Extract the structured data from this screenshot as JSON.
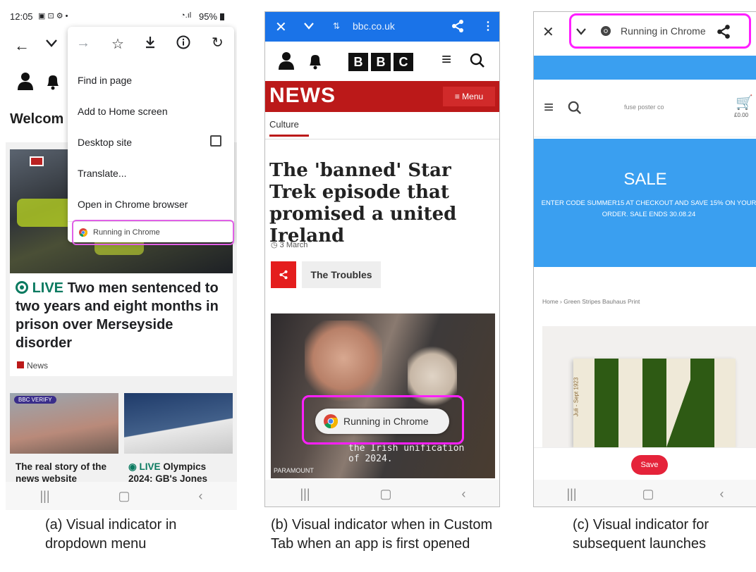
{
  "panel_a": {
    "status": {
      "time": "12:05",
      "battery": "95%"
    },
    "page_heading": "Welcom",
    "menu": {
      "items": [
        "Find in page",
        "Add to Home screen",
        "Desktop site",
        "Translate...",
        "Open in Chrome browser"
      ],
      "indicator": "Running in Chrome"
    },
    "headline_live": "LIVE",
    "headline": "Two men sentenced to two years and eight months in prison over Merseyside disorder",
    "source": "News",
    "verify_badge": "VERIFY",
    "card1": "The real story of the news website",
    "card2_live": "LIVE",
    "card2": "Olympics 2024: GB's Jones",
    "caption": "(a) Visual indicator in dropdown menu"
  },
  "panel_b": {
    "url": "bbc.co.uk",
    "logo_letters": [
      "B",
      "B",
      "C"
    ],
    "news_label": "NEWS",
    "menu_label": "Menu",
    "section": "Culture",
    "headline": "The 'banned' Star Trek episode that promised a united Ireland",
    "date": "3 March",
    "tag": "The Troubles",
    "indicator": "Running in Chrome",
    "subtitle": "the Irish unification of 2024.",
    "credit": "PARAMOUNT",
    "caption": "(b) Visual indicator when in Custom Tab when an app is first opened"
  },
  "panel_c": {
    "indicator": "Running in Chrome",
    "site_name": "fuse poster co",
    "cart_amount": "£0.00",
    "sale_title": "SALE",
    "sale_text": "ENTER CODE SUMMER15 AT CHECKOUT AND SAVE 15% ON YOUR ORDER. SALE ENDS 30.08.24",
    "breadcrumb": "Home › Green Stripes Bauhaus Print",
    "poster_text": "Juli - Sept 1923",
    "save_label": "Save",
    "caption": "(c) Visual indicator for subsequent launches"
  },
  "colors": {
    "bbc_red": "#bb1919",
    "chrome_blue": "#1a73e8",
    "highlight": "#ff1fff",
    "sale_blue": "#3a9ff0",
    "live_green": "#0a7a60"
  }
}
